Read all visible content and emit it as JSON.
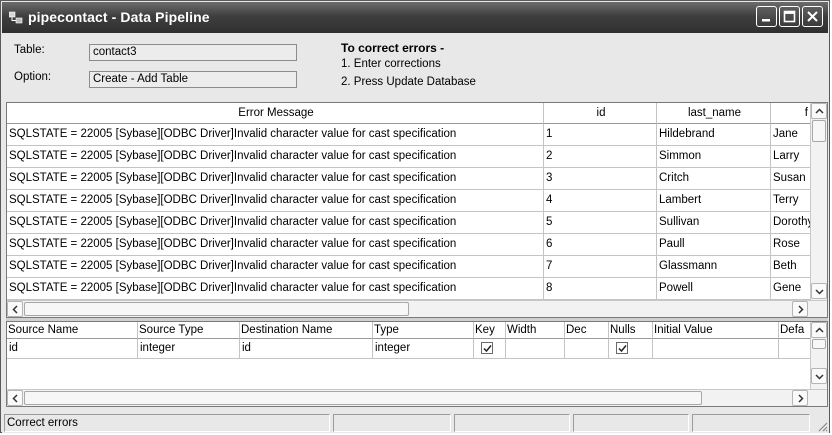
{
  "window": {
    "title": "pipecontact - Data Pipeline",
    "minimize_icon": "minimize-icon",
    "maximize_icon": "maximize-icon",
    "close_icon": "close-icon"
  },
  "header": {
    "table_label": "Table:",
    "table_value": "contact3",
    "option_label": "Option:",
    "option_value": "Create - Add Table",
    "instructions_title": "To correct errors -",
    "instruction_1": "1. Enter corrections",
    "instruction_2": "2. Press Update Database"
  },
  "error_grid": {
    "columns": [
      "Error Message",
      "id",
      "last_name",
      "f"
    ],
    "rows": [
      [
        "SQLSTATE = 22005  [Sybase][ODBC Driver]Invalid character value for cast specification",
        "1",
        "Hildebrand",
        "Jane"
      ],
      [
        "SQLSTATE = 22005  [Sybase][ODBC Driver]Invalid character value for cast specification",
        "2",
        "Simmon",
        "Larry"
      ],
      [
        "SQLSTATE = 22005  [Sybase][ODBC Driver]Invalid character value for cast specification",
        "3",
        "Critch",
        "Susan"
      ],
      [
        "SQLSTATE = 22005  [Sybase][ODBC Driver]Invalid character value for cast specification",
        "4",
        "Lambert",
        "Terry"
      ],
      [
        "SQLSTATE = 22005  [Sybase][ODBC Driver]Invalid character value for cast specification",
        "5",
        "Sullivan",
        "Dorothy"
      ],
      [
        "SQLSTATE = 22005  [Sybase][ODBC Driver]Invalid character value for cast specification",
        "6",
        "Paull",
        "Rose"
      ],
      [
        "SQLSTATE = 22005  [Sybase][ODBC Driver]Invalid character value for cast specification",
        "7",
        "Glassmann",
        "Beth"
      ],
      [
        "SQLSTATE = 22005  [Sybase][ODBC Driver]Invalid character value for cast specification",
        "8",
        "Powell",
        "Gene"
      ]
    ]
  },
  "column_grid": {
    "columns": [
      "Source Name",
      "Source Type",
      "Destination Name",
      "Type",
      "Key",
      "Width",
      "Dec",
      "Nulls",
      "Initial Value",
      "Defa"
    ],
    "rows": [
      {
        "source_name": "id",
        "source_type": "integer",
        "destination_name": "id",
        "type": "integer",
        "key": true,
        "width": "",
        "dec": "",
        "nulls": true,
        "initial_value": "",
        "default": ""
      }
    ]
  },
  "statusbar": {
    "message": "Correct errors"
  },
  "colors": {
    "titlebar": "#3f3f3f",
    "window_bg": "#e8e8e8",
    "grid_bg": "#ffffff"
  }
}
